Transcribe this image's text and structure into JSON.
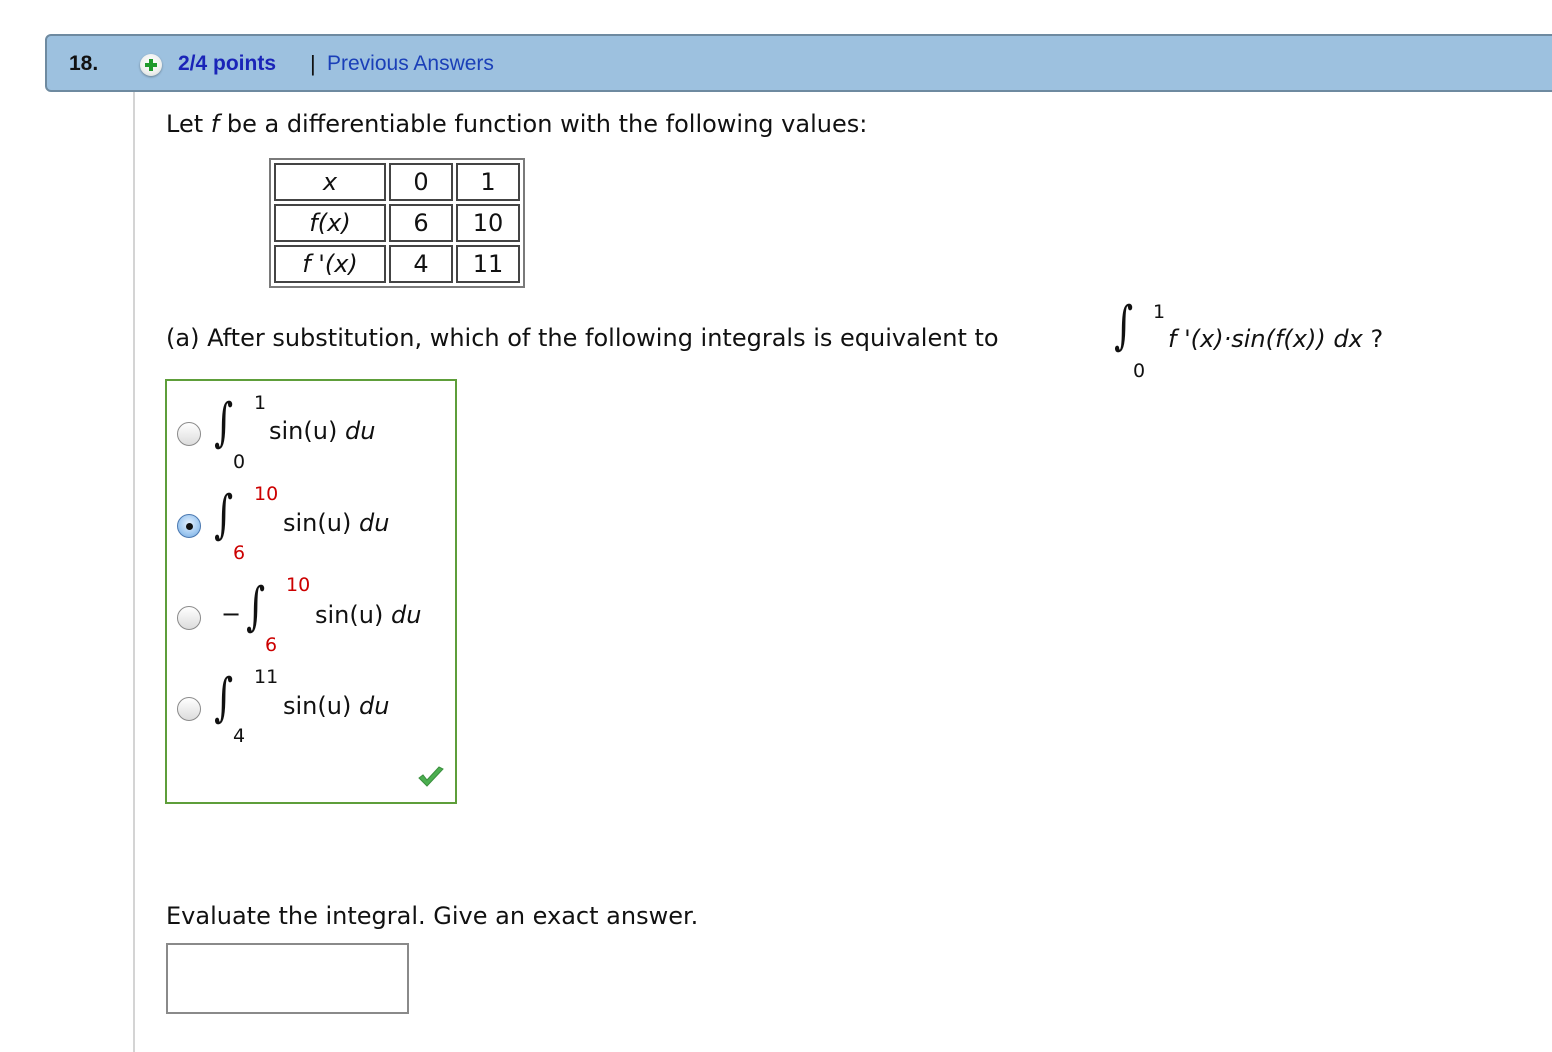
{
  "header": {
    "question_number": "18.",
    "status_icon": "plus-circle-icon",
    "points": "2/4 points",
    "separator": "|",
    "previous_answers_label": "Previous Answers"
  },
  "intro": {
    "prefix": "Let ",
    "func": "f",
    "suffix": " be a differentiable function with the following values:"
  },
  "values_table": {
    "rows": [
      {
        "label": "x",
        "v0": "0",
        "v1": "1"
      },
      {
        "label": "f(x)",
        "v0": "6",
        "v1": "10"
      },
      {
        "label": "f '(x)",
        "v0": "4",
        "v1": "11"
      }
    ]
  },
  "part_a": {
    "question": "(a) After substitution, which of the following integrals is equivalent to",
    "integral": {
      "lower": "0",
      "upper": "1",
      "integrand": "f '(x)·sin(f(x))",
      "differential": "dx",
      "trailing": "?"
    }
  },
  "choices": [
    {
      "sign": "",
      "lower": "0",
      "upper": "1",
      "integrand": "sin(u)",
      "differential": "du",
      "selected": false,
      "limits_highlighted": false
    },
    {
      "sign": "",
      "lower": "6",
      "upper": "10",
      "integrand": "sin(u)",
      "differential": "du",
      "selected": true,
      "limits_highlighted": true
    },
    {
      "sign": "−",
      "lower": "6",
      "upper": "10",
      "integrand": "sin(u)",
      "differential": "du",
      "selected": false,
      "limits_highlighted": true
    },
    {
      "sign": "",
      "lower": "4",
      "upper": "11",
      "integrand": "sin(u)",
      "differential": "du",
      "selected": false,
      "limits_highlighted": false
    }
  ],
  "result_icon": "checkmark-icon",
  "colors": {
    "header_bg": "#9dc1df",
    "points": "#1a24b8",
    "link": "#1a3fb8",
    "correct_border": "#5e9e3a",
    "highlight_limit": "#cc0000",
    "check": "#4caf50"
  },
  "part_b": {
    "prompt": "Evaluate the integral. Give an exact answer.",
    "answer_value": "",
    "answer_placeholder": ""
  }
}
